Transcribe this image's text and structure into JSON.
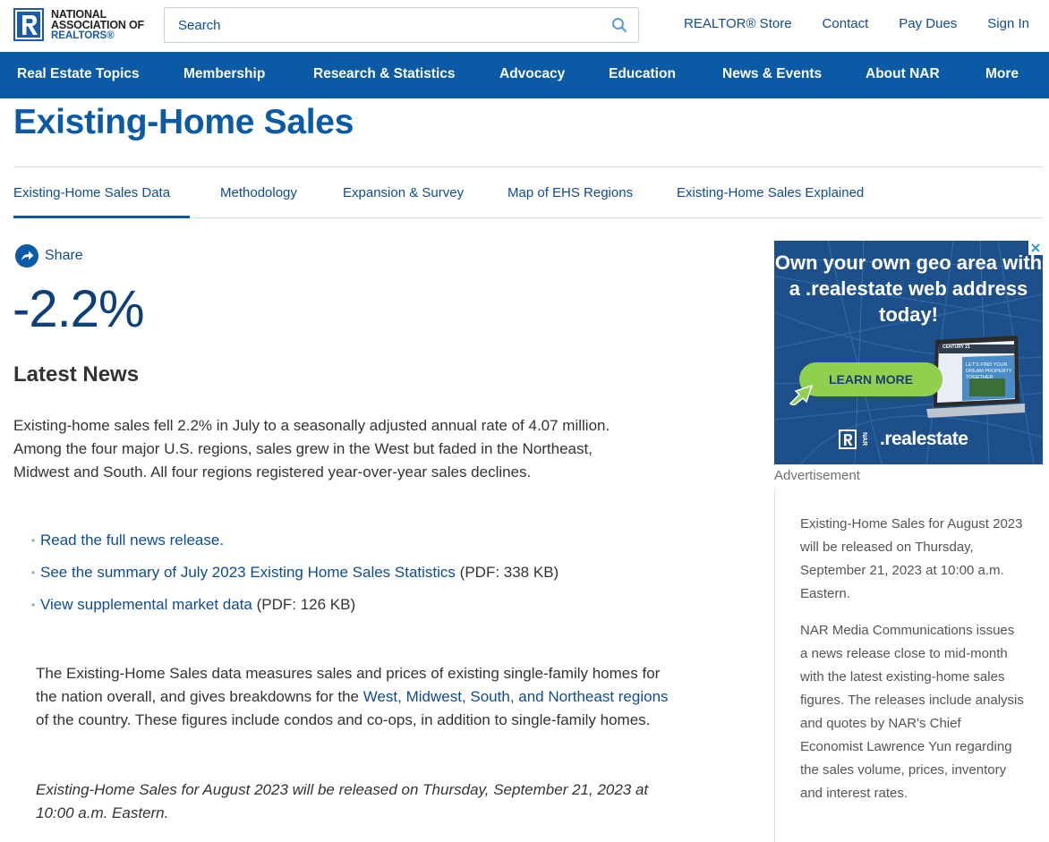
{
  "header": {
    "logo": {
      "line1": "NATIONAL",
      "line2": "ASSOCIATION OF",
      "line3": "REALTORS®"
    },
    "search": {
      "placeholder": "Search",
      "value": ""
    },
    "links": [
      "REALTOR® Store",
      "Contact",
      "Pay Dues",
      "Sign In"
    ]
  },
  "nav": {
    "items": [
      "Real Estate Topics",
      "Membership",
      "Research & Statistics",
      "Advocacy",
      "Education",
      "News & Events",
      "About NAR",
      "More"
    ]
  },
  "page": {
    "title": "Existing-Home Sales",
    "tabs": [
      "Existing-Home Sales Data",
      "Methodology",
      "Expansion & Survey",
      "Map of EHS Regions",
      "Existing-Home Sales Explained"
    ],
    "active_tab": "Existing-Home Sales Data"
  },
  "main": {
    "share_label": "Share",
    "big_stat": "-2.2%",
    "latest_news_heading": "Latest News",
    "news_paragraph": "Existing-home sales fell 2.2% in July to a seasonally adjusted annual rate of 4.07 million. Among the four major U.S. regions, sales grew in the West but faded in the Northeast, Midwest and South. All four regions registered year-over-year sales declines.",
    "links": [
      {
        "text": "Read the full news release.",
        "suffix": ""
      },
      {
        "text": "See the summary of July 2023 Existing Home Sales Statistics",
        "suffix": " (PDF: 338 KB)"
      },
      {
        "text": "View supplemental market data",
        "suffix": " (PDF: 126 KB)"
      }
    ],
    "description": {
      "before": "The Existing-Home Sales data measures sales and prices of existing single-family homes for the nation overall, and gives breakdowns for the ",
      "link": "West, Midwest, South, and Northeast regions",
      "after": " of the country. These figures include condos and co-ops, in addition to single-family homes."
    },
    "release_note": "Existing-Home Sales for August 2023 will be released on Thursday, September 21, 2023 at 10:00 a.m. Eastern."
  },
  "sidebar": {
    "ad": {
      "headline": "Own your own geo area with a .realestate web address today!",
      "cta": "LEARN MORE",
      "brand_domain": ".realestate",
      "brand_mark": "NAR",
      "laptop_text": "LET'S FIND YOUR DREAM PROPERTY TOGETHER",
      "laptop_brand": "CENTURY 21"
    },
    "ad_label": "Advertisement",
    "release_text": "Existing-Home Sales for August 2023 will be released on Thursday, September 21, 2023 at 10:00 a.m. Eastern.",
    "media_text": "NAR Media Communications issues a news release close to mid-month with the latest existing-home sales figures. The releases include analysis and quotes by NAR's Chief Economist Lawrence Yun regarding the sales volume, prices, inventory and interest rates."
  },
  "colors": {
    "brand_blue": "#0a5aa6",
    "link_blue": "#0f4c8f",
    "stat_blue": "#0d3f7a",
    "ad_green": "#8fd14f"
  }
}
